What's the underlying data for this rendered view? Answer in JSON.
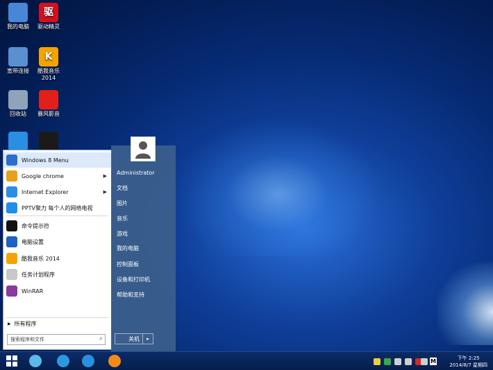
{
  "desktop": {
    "icons": [
      {
        "label": "我的电脑",
        "icon": "computer-icon",
        "color": "#4a86d8"
      },
      {
        "label": "驱动精灵",
        "icon": "driver-icon",
        "color": "#d2101e",
        "glyph": "驱"
      },
      {
        "label": "宽带连接",
        "icon": "network-icon",
        "color": "#5a8fd0"
      },
      {
        "label": "酷我音乐\n2014",
        "icon": "kuwo-icon",
        "color": "#f5a300",
        "glyph": "K"
      },
      {
        "label": "回收站",
        "icon": "recycle-bin-icon",
        "color": "#8fa4bb"
      },
      {
        "label": "暴风影音",
        "icon": "baofeng-icon",
        "color": "#e0201b"
      },
      {
        "label": "",
        "icon": "ie-icon",
        "color": "#2a8fe0"
      },
      {
        "label": "",
        "icon": "qq-icon",
        "color": "#1a1a1a"
      }
    ]
  },
  "start_menu": {
    "items": [
      {
        "label": "Windows 8 Menu",
        "icon": "windows8-menu-icon",
        "color": "#2b6fc9",
        "arrow": false,
        "selected": true
      },
      {
        "label": "Google chrome",
        "icon": "chrome-icon",
        "color": "#e5a21a",
        "arrow": true
      },
      {
        "label": "Internet Explorer",
        "icon": "ie-icon",
        "color": "#2a8fe0",
        "arrow": true
      },
      {
        "label": "PPTV聚力 每个人的网络电视",
        "icon": "pptv-icon",
        "color": "#1e8fe8",
        "arrow": false
      },
      {
        "label": "命令提示符",
        "icon": "cmd-icon",
        "color": "#111111",
        "arrow": false
      },
      {
        "label": "电脑设置",
        "icon": "settings-icon",
        "color": "#2062c4",
        "arrow": false
      },
      {
        "label": "酷我音乐 2014",
        "icon": "kuwo-icon",
        "color": "#f5a300",
        "arrow": false
      },
      {
        "label": "任务计划程序",
        "icon": "clock-icon",
        "color": "#c8c8c8",
        "arrow": false
      },
      {
        "label": "WinRAR",
        "icon": "winrar-icon",
        "color": "#8b3a9e",
        "arrow": false
      }
    ],
    "all_programs": "所有程序",
    "search_placeholder": "搜索程序和文件",
    "right_items": [
      "Administrator",
      "文档",
      "图片",
      "音乐",
      "游戏",
      "我的电脑",
      "控制面板",
      "设备和打印机",
      "帮助和支持"
    ],
    "shutdown_label": "关机",
    "shutdown_arrow": "▸"
  },
  "taskbar": {
    "start_icon": "windows-logo-icon",
    "pinned": [
      {
        "icon": "drive-icon",
        "color": "#5bb8e8"
      },
      {
        "icon": "q-search-icon",
        "color": "#2a9ae0"
      },
      {
        "icon": "ie-icon",
        "color": "#2a8fe0"
      },
      {
        "icon": "uc-browser-icon",
        "color": "#f08a1a"
      }
    ],
    "tray": [
      {
        "icon": "tray-app-icon",
        "color": "#e6d23a"
      },
      {
        "icon": "shield-icon",
        "color": "#3aa84a"
      },
      {
        "icon": "action-center-icon",
        "color": "#d0d0d0"
      },
      {
        "icon": "network-tray-icon",
        "color": "#cfcfcf"
      },
      {
        "icon": "warning-icon",
        "color": "#d02a2a"
      },
      {
        "icon": "volume-icon",
        "color": "#cfcfcf"
      }
    ],
    "ime_label": "M",
    "time": "下午 2:25",
    "date": "2014/8/7 星期四"
  }
}
